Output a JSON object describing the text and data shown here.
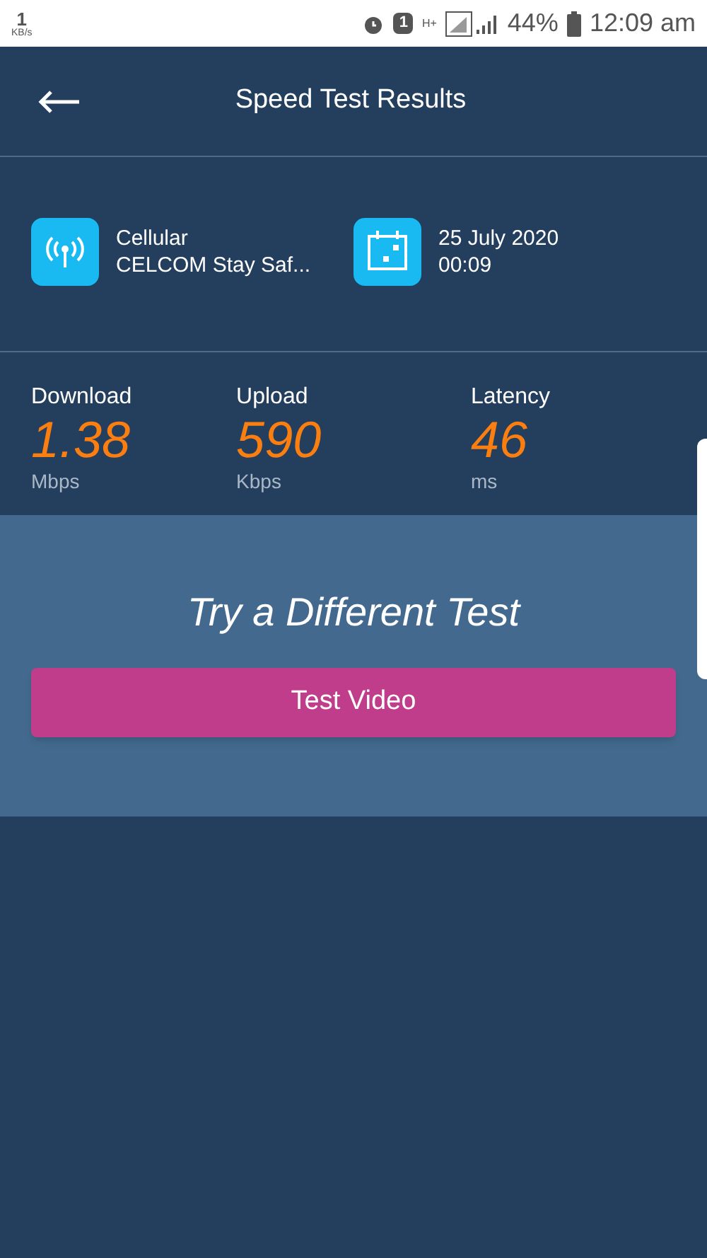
{
  "status_bar": {
    "speed": "1",
    "speed_unit": "KB/s",
    "network": "H+",
    "sim": "1",
    "battery": "44%",
    "time": "12:09 am"
  },
  "header": {
    "title": "Speed Test Results"
  },
  "info": [
    {
      "kind": "network",
      "line1": "Cellular",
      "line2": "CELCOM Stay Saf..."
    },
    {
      "kind": "date",
      "line1": "25 July 2020",
      "line2": "00:09"
    }
  ],
  "metrics": [
    {
      "label": "Download",
      "value": "1.38",
      "unit": "Mbps"
    },
    {
      "label": "Upload",
      "value": "590",
      "unit": "Kbps"
    },
    {
      "label": "Latency",
      "value": "46",
      "unit": "ms"
    }
  ],
  "promo": {
    "title": "Try a Different Test",
    "button": "Test Video"
  }
}
